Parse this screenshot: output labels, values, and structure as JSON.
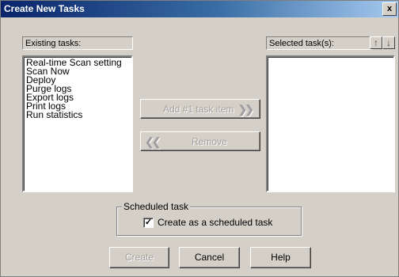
{
  "window": {
    "title": "Create New Tasks",
    "close_label": "x"
  },
  "existing": {
    "header": "Existing tasks:",
    "items": [
      "Real-time Scan setting",
      "Scan Now",
      "Deploy",
      "Purge logs",
      "Export logs",
      "Print logs",
      "Run statistics"
    ]
  },
  "selected": {
    "header": "Selected task(s):",
    "up_icon": "arrow-up-icon",
    "down_icon": "arrow-down-icon"
  },
  "buttons": {
    "add_label": "Add  #1  task item",
    "add_icon": "double-right-arrow-icon",
    "remove_label": "Remove",
    "remove_icon": "double-left-arrow-icon",
    "create_label": "Create",
    "cancel_label": "Cancel",
    "help_label": "Help"
  },
  "schedule": {
    "legend": "Scheduled task",
    "checkbox_label": "Create as a scheduled task",
    "checked": true
  },
  "colors": {
    "face": "#d4d0c8",
    "title_start": "#0a246a",
    "title_end": "#a6caf0",
    "disabled_text": "#a0a0a0"
  }
}
